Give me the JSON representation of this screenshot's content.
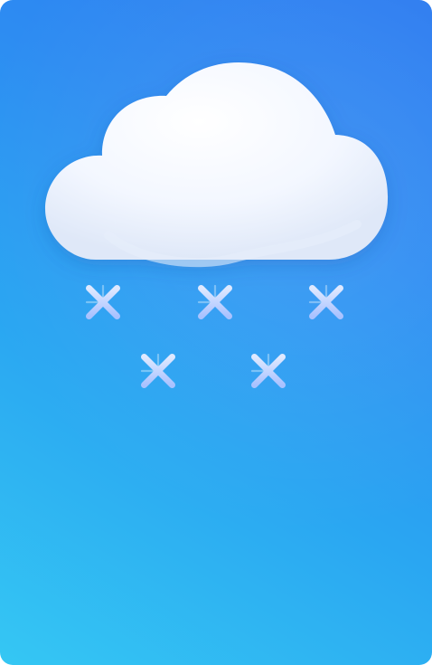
{
  "colors": {
    "background_top": "#2c7bf0",
    "background_bottom": "#35c7f3",
    "cloud": "#ffffff",
    "snowflake": "#bfd6ff"
  },
  "illustration": {
    "icon": "snow-cloud-icon",
    "snowflakes": 5
  }
}
